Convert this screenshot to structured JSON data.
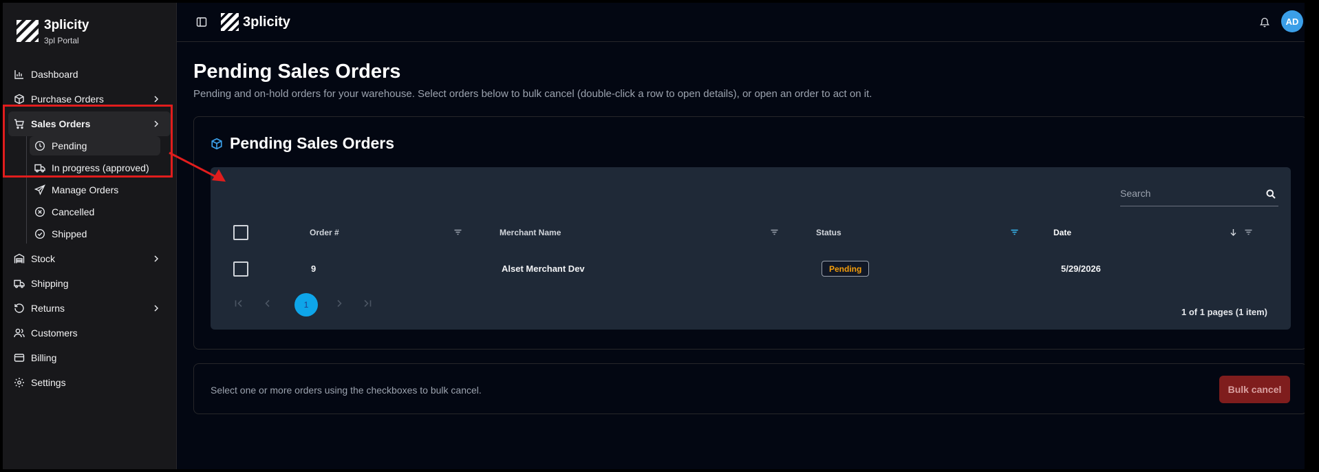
{
  "app": {
    "brand_name": "3plicity",
    "brand_sub": "3pl Portal",
    "user_initials": "AD"
  },
  "sidebar": {
    "items": [
      {
        "label": "Dashboard",
        "icon": "bar-chart-icon"
      },
      {
        "label": "Purchase Orders",
        "icon": "package-icon"
      },
      {
        "label": "Sales Orders",
        "icon": "cart-icon"
      },
      {
        "label": "Stock",
        "icon": "warehouse-icon"
      },
      {
        "label": "Shipping",
        "icon": "truck-icon"
      },
      {
        "label": "Returns",
        "icon": "rotate-ccw-icon"
      },
      {
        "label": "Customers",
        "icon": "users-icon"
      },
      {
        "label": "Billing",
        "icon": "credit-card-icon"
      },
      {
        "label": "Settings",
        "icon": "gear-icon"
      }
    ],
    "sales_sub": [
      {
        "label": "Pending",
        "icon": "clock-icon"
      },
      {
        "label": "In progress (approved)",
        "icon": "truck-icon"
      },
      {
        "label": "Manage Orders",
        "icon": "send-icon"
      },
      {
        "label": "Cancelled",
        "icon": "x-circle-icon"
      },
      {
        "label": "Shipped",
        "icon": "check-circle-icon"
      }
    ]
  },
  "page": {
    "title": "Pending Sales Orders",
    "subtitle": "Pending and on-hold orders for your warehouse. Select orders below to bulk cancel (double-click a row to open details), or open an order to act on it."
  },
  "card": {
    "title": "Pending Sales Orders",
    "search_placeholder": "Search",
    "columns": [
      "Order #",
      "Merchant Name",
      "Status",
      "Date"
    ],
    "rows": [
      {
        "order": "9",
        "merchant": "Alset Merchant Dev",
        "status": "Pending",
        "date": "5/29/2026"
      }
    ],
    "current_page": "1",
    "pager_info": "1 of 1 pages (1 item)"
  },
  "bulk": {
    "hint": "Select one or more orders using the checkboxes to bulk cancel.",
    "button": "Bulk cancel"
  },
  "colors": {
    "accent": "#0ea5e9",
    "annotation": "#e11d1d",
    "status_pending": "#f59e0b",
    "danger": "#7f1d1d"
  }
}
